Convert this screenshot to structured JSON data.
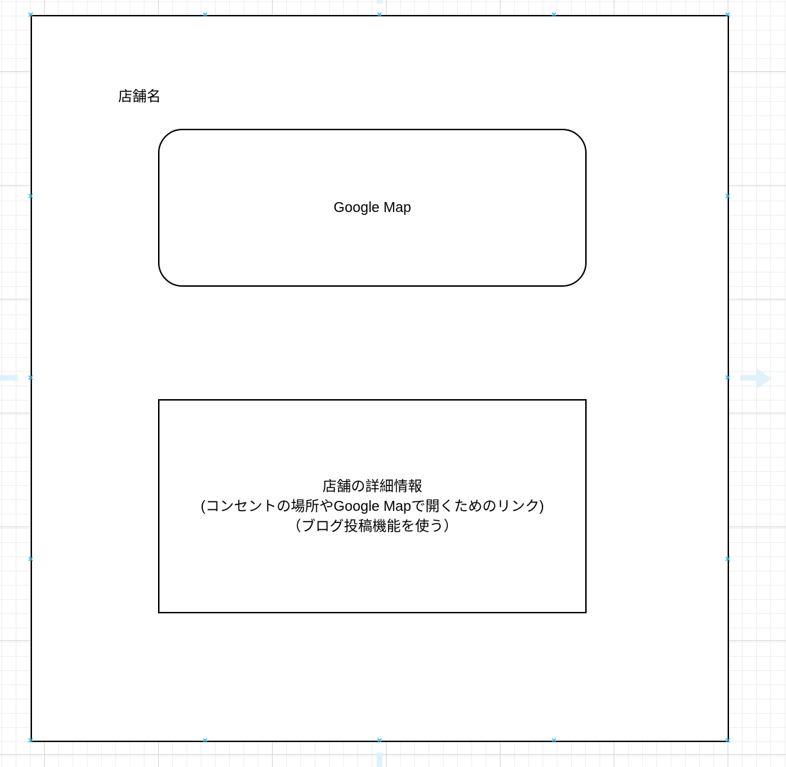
{
  "diagram": {
    "store_name_label": "店舗名",
    "map_box_label": "Google Map",
    "detail_box_lines": [
      "店舗の詳細情報",
      "(コンセントの場所やGoogle Mapで開くためのリンク)",
      "（ブログ投稿機能を使う）"
    ]
  },
  "colors": {
    "selection_handle": "#29b6f2",
    "hover_arrow": "#dff2fb"
  }
}
